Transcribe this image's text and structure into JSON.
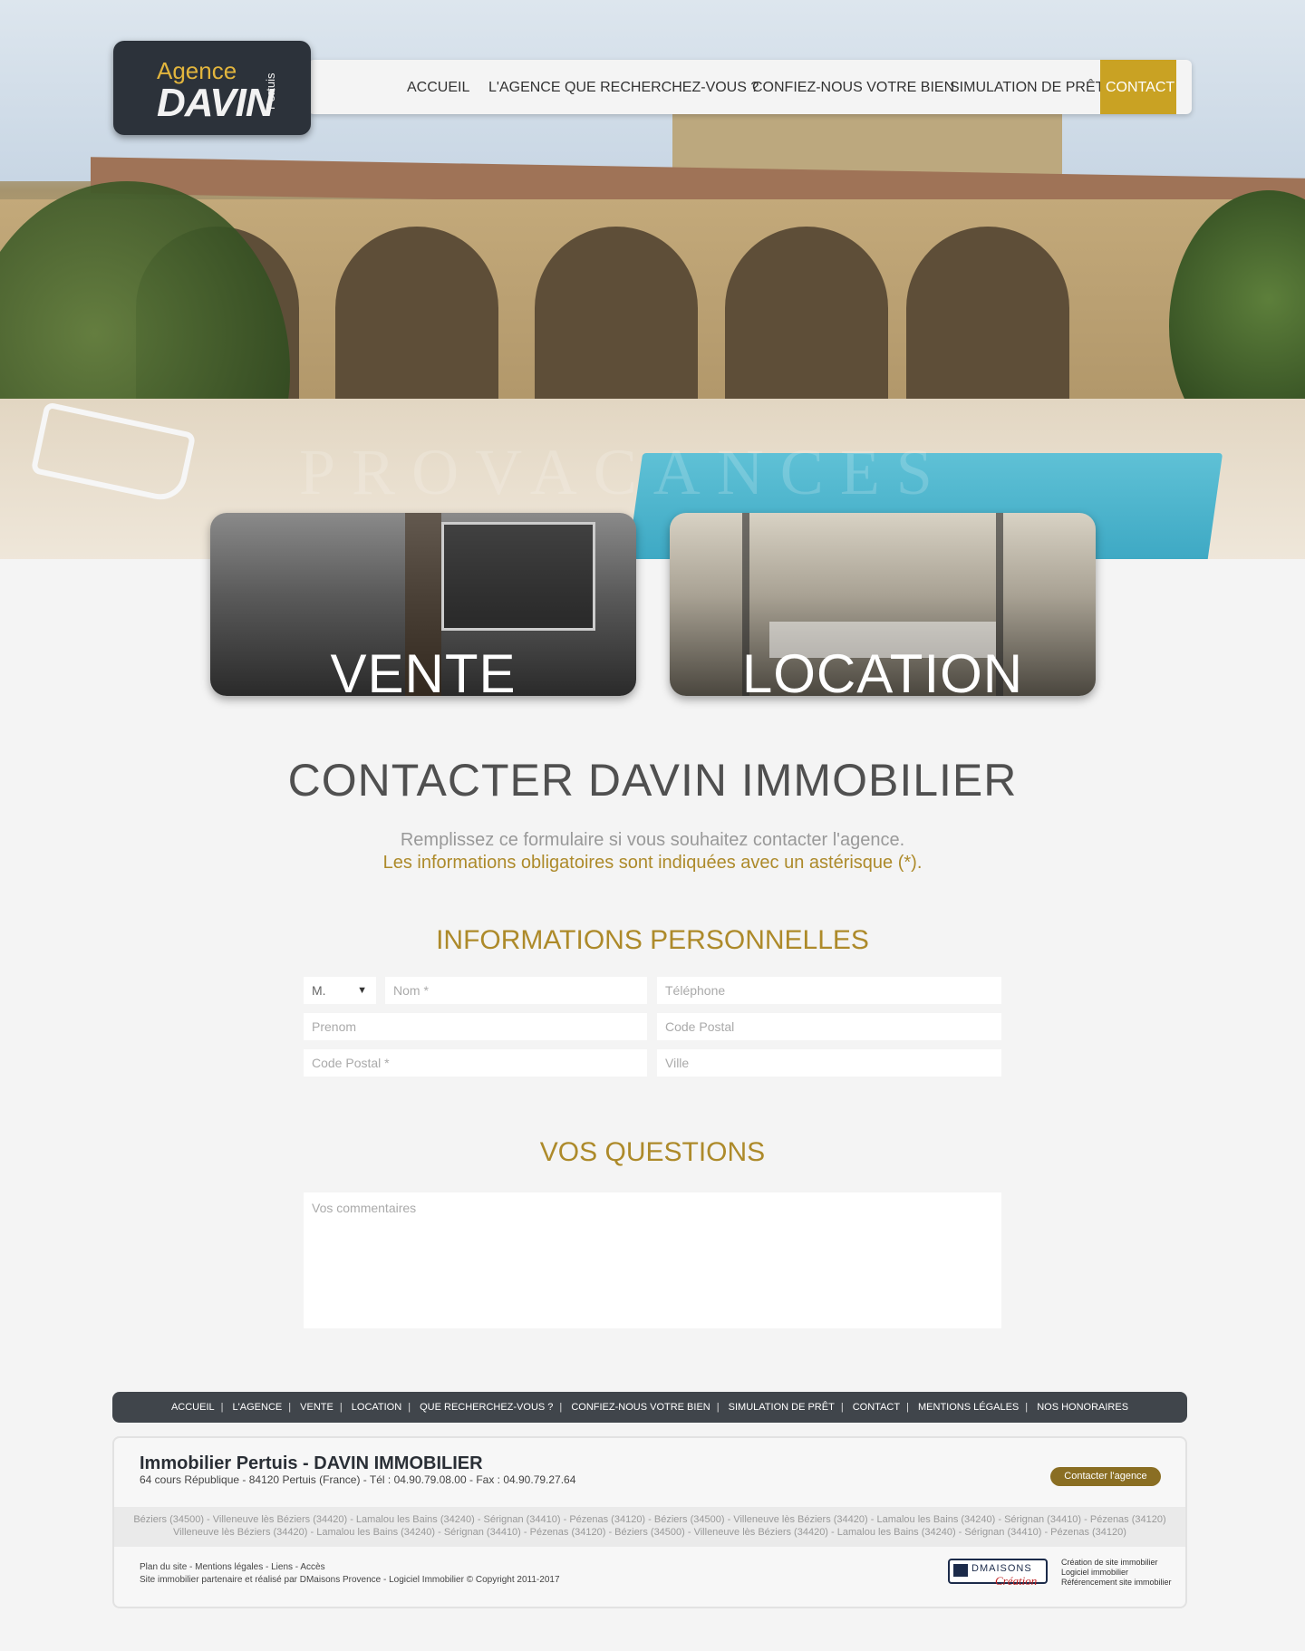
{
  "header": {
    "logo": {
      "agence": "Agence",
      "davin": "DAVIN",
      "pertuis": "Pertuis"
    },
    "nav": [
      "ACCUEIL",
      "L'AGENCE",
      "QUE RECHERCHEZ-VOUS ?",
      "CONFIEZ-NOUS VOTRE BIEN",
      "SIMULATION DE PRÊT",
      "CONTACT"
    ],
    "active_color": "#c9a223"
  },
  "hero": {
    "watermark": "PROVACANCES"
  },
  "tiles": {
    "vente": "VENTE",
    "location": "LOCATION"
  },
  "main": {
    "title": "CONTACTER DAVIN IMMOBILIER",
    "intro_line1": "Remplissez ce formulaire si vous souhaitez contacter l'agence.",
    "intro_line2": "Les informations obligatoires sont indiquées avec un astérisque (*).",
    "section_personal": "INFORMATIONS PERSONNELLES",
    "civility": {
      "selected": "M."
    },
    "fields": {
      "nom": "Nom *",
      "telephone": "Téléphone",
      "prenom": "Prenom",
      "code_postal_right": "Code Postal",
      "code_postal_required": "Code Postal *",
      "ville": "Ville"
    },
    "section_questions": "VOS QUESTIONS",
    "comments_placeholder": "Vos commentaires",
    "accent_color": "#ad8a2a"
  },
  "footer": {
    "nav": [
      "ACCUEIL",
      "L'AGENCE",
      "VENTE",
      "LOCATION",
      "QUE RECHERCHEZ-VOUS ?",
      "CONFIEZ-NOUS VOTRE BIEN",
      "SIMULATION DE PRÊT",
      "CONTACT",
      "MENTIONS LÉGALES",
      "NOS HONORAIRES"
    ],
    "company": "Immobilier Pertuis - DAVIN IMMOBILIER",
    "address": "64 cours République - 84120 Pertuis (France) - Tél : 04.90.79.08.00 - Fax : 04.90.79.27.64",
    "contact_button": "Contacter l'agence",
    "cities_line1": "Béziers (34500) - Villeneuve lès Béziers (34420) - Lamalou les Bains (34240) - Sérignan (34410) - Pézenas (34120) - Béziers (34500) - Villeneuve lès Béziers (34420) - Lamalou les Bains (34240) - Sérignan (34410) - Pézenas (34120)",
    "cities_line2": "Villeneuve lès Béziers (34420) - Lamalou les Bains (34240) - Sérignan (34410) - Pézenas (34120) - Béziers (34500) - Villeneuve lès Béziers (34420) - Lamalou les Bains (34240) - Sérignan (34410) - Pézenas (34120)",
    "links": [
      "Plan du site",
      "Mentions légales",
      "Liens",
      "Accès"
    ],
    "credit": "Site immobilier partenaire et réalisé par DMaisons Provence - Logiciel Immobilier © Copyright 2011-2017",
    "dm_logo": {
      "brand": "DMAISONS",
      "sub": "Création"
    },
    "dm_lines": [
      "Création de site immobilier",
      "Logiciel immobilier",
      "Référencement site immobilier"
    ],
    "footer_nav_bg": "#40454b",
    "button_color": "#8a6e23"
  }
}
